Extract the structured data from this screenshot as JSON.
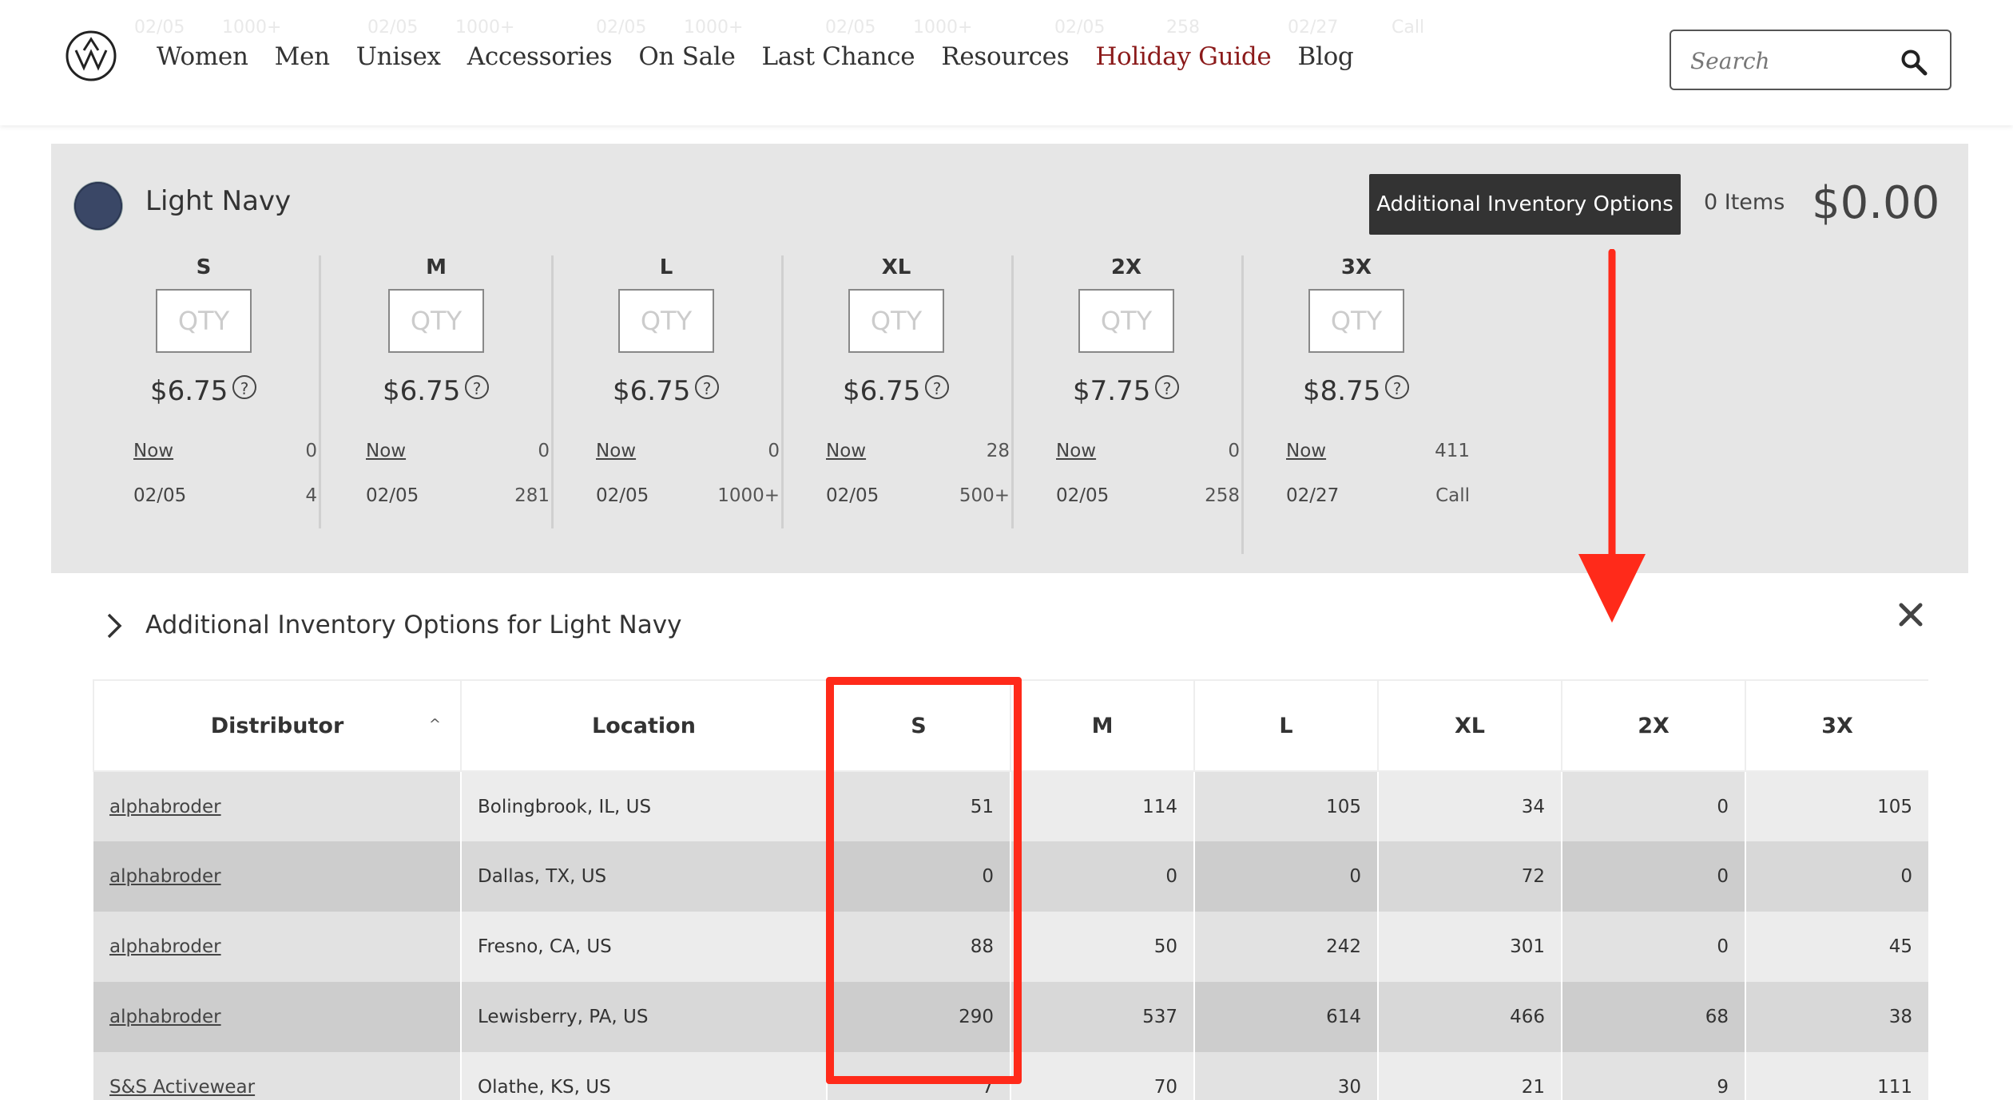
{
  "ghost_text": [
    "02/05",
    "1000+",
    "02/05",
    "1000+",
    "02/05",
    "1000+",
    "02/05",
    "1000+",
    "02/05",
    "258",
    "02/27",
    "Call"
  ],
  "header": {
    "nav": [
      "Women",
      "Men",
      "Unisex",
      "Accessories",
      "On Sale",
      "Last Chance",
      "Resources",
      "Holiday Guide",
      "Blog"
    ],
    "highlight_color": "#8b1a1a",
    "search_placeholder": "Search"
  },
  "panel": {
    "color_name": "Light Navy",
    "swatch_color": "#3a4766",
    "button_label": "Additional Inventory Options",
    "items_count": "0 Items",
    "total": "$0.00",
    "qty_placeholder": "QTY",
    "help_glyph": "?",
    "sizes": [
      {
        "label": "S",
        "price": "$6.75",
        "now_label": "Now",
        "now_value": "0",
        "date": "02/05",
        "date_value": "4"
      },
      {
        "label": "M",
        "price": "$6.75",
        "now_label": "Now",
        "now_value": "0",
        "date": "02/05",
        "date_value": "281"
      },
      {
        "label": "L",
        "price": "$6.75",
        "now_label": "Now",
        "now_value": "0",
        "date": "02/05",
        "date_value": "1000+"
      },
      {
        "label": "XL",
        "price": "$6.75",
        "now_label": "Now",
        "now_value": "28",
        "date": "02/05",
        "date_value": "500+"
      },
      {
        "label": "2X",
        "price": "$7.75",
        "now_label": "Now",
        "now_value": "0",
        "date": "02/05",
        "date_value": "258"
      },
      {
        "label": "3X",
        "price": "$8.75",
        "now_label": "Now",
        "now_value": "411",
        "date": "02/27",
        "date_value": "Call"
      }
    ]
  },
  "additional": {
    "title": "Additional Inventory Options for Light Navy",
    "columns": [
      "Distributor",
      "Location",
      "S",
      "M",
      "L",
      "XL",
      "2X",
      "3X"
    ],
    "rows": [
      {
        "distributor": "alphabroder",
        "location": "Bolingbrook, IL, US",
        "values": [
          "51",
          "114",
          "105",
          "34",
          "0",
          "105"
        ]
      },
      {
        "distributor": "alphabroder",
        "location": "Dallas, TX, US",
        "values": [
          "0",
          "0",
          "0",
          "72",
          "0",
          "0"
        ]
      },
      {
        "distributor": "alphabroder",
        "location": "Fresno, CA, US",
        "values": [
          "88",
          "50",
          "242",
          "301",
          "0",
          "45"
        ]
      },
      {
        "distributor": "alphabroder",
        "location": "Lewisberry, PA, US",
        "values": [
          "290",
          "537",
          "614",
          "466",
          "68",
          "38"
        ]
      },
      {
        "distributor": "S&S Activewear",
        "location": "Olathe, KS, US",
        "values": [
          "7",
          "70",
          "30",
          "21",
          "9",
          "111"
        ]
      }
    ]
  },
  "annotation_color": "#ff2a1a"
}
